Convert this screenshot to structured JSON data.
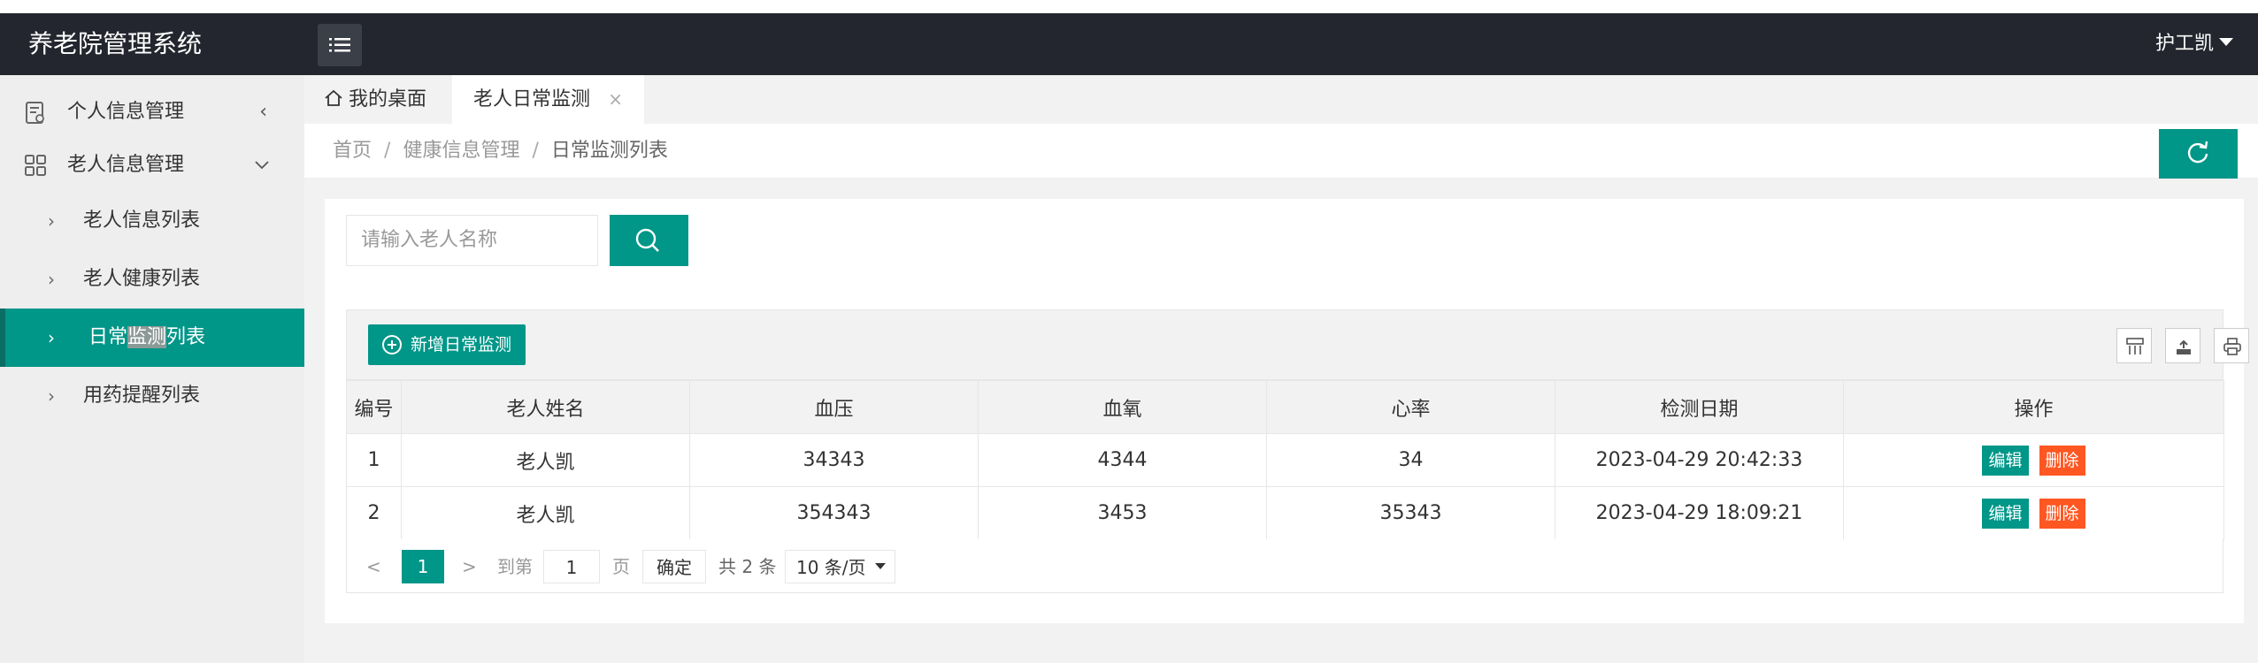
{
  "header": {
    "app_title": "养老院管理系统",
    "user_name": "护工凯",
    "menu_icon": "list-icon"
  },
  "sidebar": {
    "groups": [
      {
        "label": "个人信息管理",
        "icon": "id-card-icon",
        "expanded": false
      },
      {
        "label": "老人信息管理",
        "icon": "grid-icon",
        "expanded": true
      }
    ],
    "items": [
      {
        "label": "老人信息列表",
        "active": false
      },
      {
        "label": "老人健康列表",
        "active": false
      },
      {
        "label_part1": "日常",
        "label_highlight": "监测",
        "label_part2": "列表",
        "active": true
      },
      {
        "label": "用药提醒列表",
        "active": false
      }
    ]
  },
  "tabs": [
    {
      "label": "我的桌面",
      "icon": "home-icon"
    },
    {
      "label": "老人日常监测",
      "closable": true,
      "close": "×"
    }
  ],
  "breadcrumb": [
    "首页",
    "健康信息管理",
    "日常监测列表"
  ],
  "breadcrumb_sep": "/",
  "search": {
    "placeholder": "请输入老人名称"
  },
  "toolbar": {
    "add_label": "新增日常监测"
  },
  "table": {
    "headers": [
      "编号",
      "老人姓名",
      "血压",
      "血氧",
      "心率",
      "检测日期",
      "操作"
    ],
    "rows": [
      {
        "id": "1",
        "name": "老人凯",
        "bp": "34343",
        "spo2": "4344",
        "hr": "34",
        "date": "2023-04-29 20:42:33"
      },
      {
        "id": "2",
        "name": "老人凯",
        "bp": "354343",
        "spo2": "3453",
        "hr": "35343",
        "date": "2023-04-29 18:09:21"
      }
    ],
    "edit_label": "编辑",
    "delete_label": "删除"
  },
  "pager": {
    "prev": "<",
    "next": ">",
    "current": "1",
    "goto_label": "到第",
    "goto_value": "1",
    "page_label": "页",
    "ok_label": "确定",
    "total": "共 2 条",
    "size": "10 条/页"
  },
  "colors": {
    "primary": "#009688",
    "danger": "#ff5722",
    "topbar": "#23262e"
  }
}
